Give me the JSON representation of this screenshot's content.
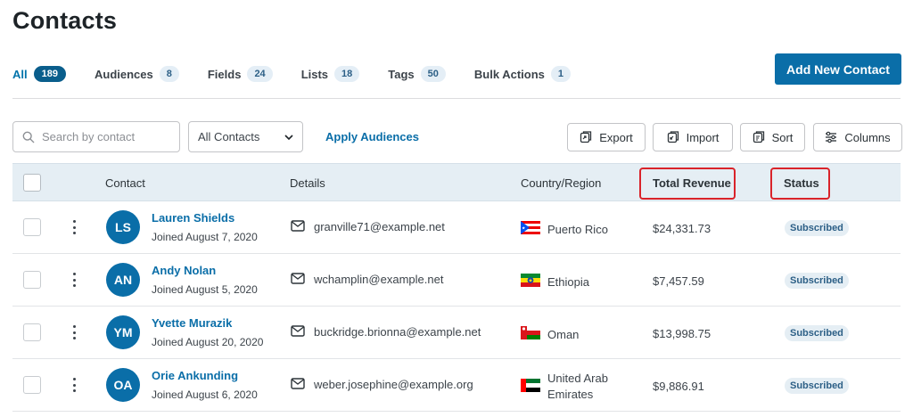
{
  "page": {
    "title": "Contacts"
  },
  "tabs": [
    {
      "label": "All",
      "count": "189"
    },
    {
      "label": "Audiences",
      "count": "8"
    },
    {
      "label": "Fields",
      "count": "24"
    },
    {
      "label": "Lists",
      "count": "18"
    },
    {
      "label": "Tags",
      "count": "50"
    },
    {
      "label": "Bulk Actions",
      "count": "1"
    }
  ],
  "actions": {
    "add_contact": "Add New Contact"
  },
  "toolbar": {
    "search_placeholder": "Search by contact",
    "filter_selected": "All Contacts",
    "apply_audiences": "Apply Audiences",
    "export": "Export",
    "import": "Import",
    "sort": "Sort",
    "columns": "Columns"
  },
  "table": {
    "headers": {
      "contact": "Contact",
      "details": "Details",
      "country": "Country/Region",
      "revenue": "Total Revenue",
      "status": "Status"
    },
    "rows": [
      {
        "initials": "LS",
        "name": "Lauren Shields",
        "joined": "Joined August 7, 2020",
        "email": "granville71@example.net",
        "country": "Puerto Rico",
        "flag": "pr",
        "revenue": "$24,331.73",
        "status": "Subscribed"
      },
      {
        "initials": "AN",
        "name": "Andy Nolan",
        "joined": "Joined August 5, 2020",
        "email": "wchamplin@example.net",
        "country": "Ethiopia",
        "flag": "et",
        "revenue": "$7,457.59",
        "status": "Subscribed"
      },
      {
        "initials": "YM",
        "name": "Yvette Murazik",
        "joined": "Joined August 20, 2020",
        "email": "buckridge.brionna@example.net",
        "country": "Oman",
        "flag": "om",
        "revenue": "$13,998.75",
        "status": "Subscribed"
      },
      {
        "initials": "OA",
        "name": "Orie Ankunding",
        "joined": "Joined August 6, 2020",
        "email": "weber.josephine@example.org",
        "country_line1": "United Arab",
        "country_line2": "Emirates",
        "flag": "ae",
        "revenue": "$9,886.91",
        "status": "Subscribed"
      }
    ]
  },
  "colors": {
    "accent": "#0a6ea8",
    "highlight_box": "#d9232a",
    "header_bg": "#e5eef4"
  }
}
